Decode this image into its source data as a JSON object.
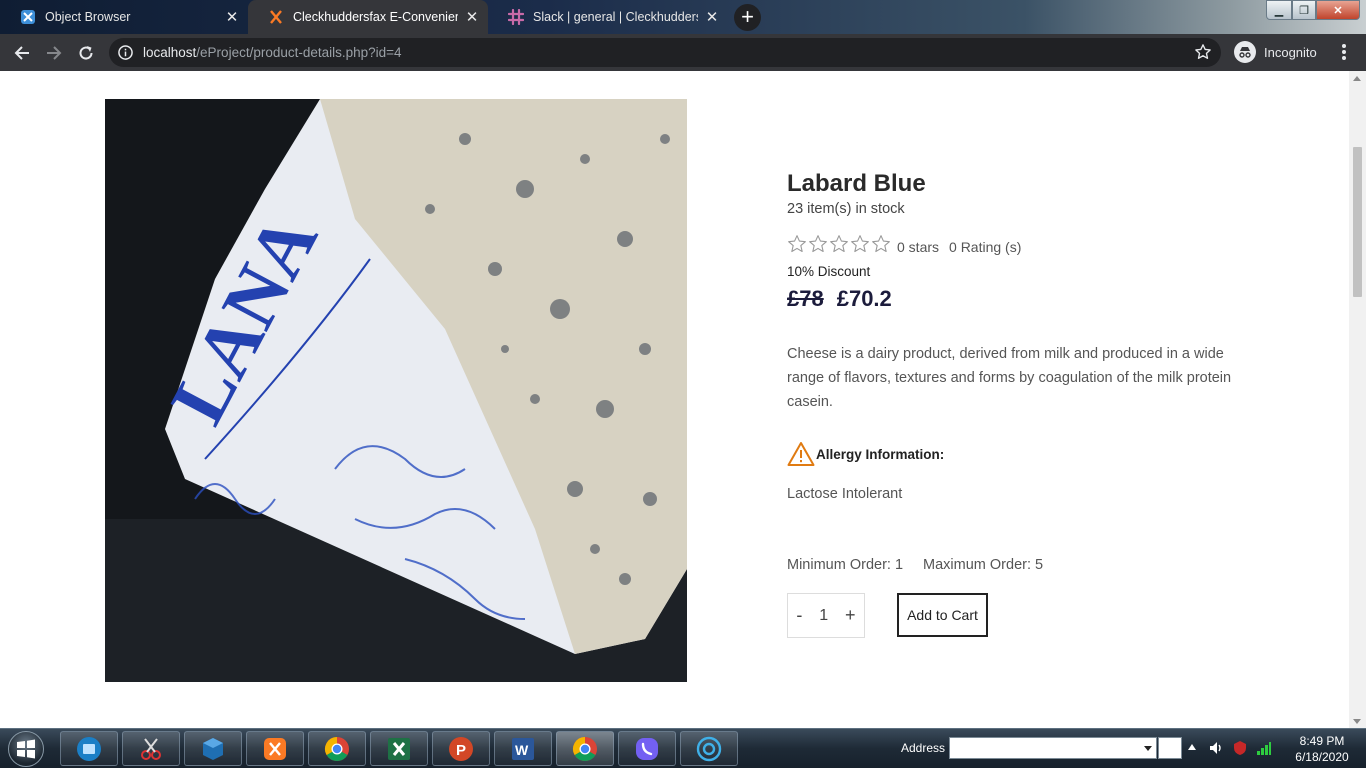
{
  "browser": {
    "tabs": [
      {
        "title": "Object Browser",
        "favicon": "object-browser-icon",
        "active": false
      },
      {
        "title": "Cleckhuddersfax E-Convenient St",
        "favicon": "xampp-icon",
        "active": true
      },
      {
        "title": "Slack | general | Cleckhuddersfax",
        "favicon": "slack-icon",
        "active": false
      }
    ],
    "new_tab_label": "+",
    "url_host": "localhost",
    "url_path": "/eProject/product-details.php?id=4",
    "profile_label": "Incognito"
  },
  "product": {
    "title": "Labard Blue",
    "stock": "23 item(s) in stock",
    "rating": {
      "stars": 0,
      "max": 5,
      "stars_label": "0 stars",
      "count_label": "0 Rating (s)"
    },
    "discount": "10% Discount",
    "old_price": "£78",
    "new_price": "£70.2",
    "description": "Cheese is a dairy product, derived from milk and produced in a wide range of flavors, textures and forms by coagulation of the milk protein casein.",
    "allergy_label": "Allergy Information:",
    "allergy_value": "Lactose Intolerant",
    "min_order": "Minimum Order: 1",
    "max_order": "Maximum Order: 5",
    "quantity": "1",
    "decrement": "-",
    "increment": "+",
    "add_to_cart": "Add to Cart",
    "image_alt": "LANA"
  },
  "taskbar": {
    "items": [
      "file-explorer-icon",
      "snipping-tool-icon",
      "virtualbox-icon",
      "xampp-icon",
      "chrome-icon",
      "excel-icon",
      "powerpoint-icon",
      "word-icon",
      "chrome-icon",
      "viber-icon",
      "app-icon"
    ],
    "address_label": "Address",
    "time": "8:49 PM",
    "date": "6/18/2020"
  },
  "colors": {
    "chrome_dark": "#35363a",
    "omnibox": "#202124",
    "price": "#1c1c3c",
    "warning": "#e07b12"
  }
}
